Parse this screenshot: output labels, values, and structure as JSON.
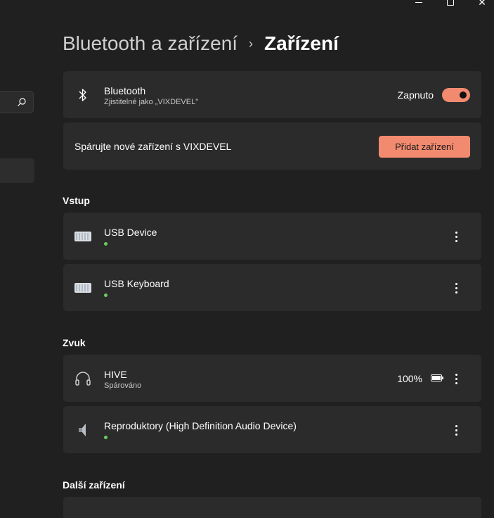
{
  "window": {
    "minimize_icon": "minimize-icon",
    "maximize_icon": "maximize-icon",
    "close_icon": "close-icon"
  },
  "nav": {
    "search_icon": "search-icon"
  },
  "breadcrumb": {
    "parent": "Bluetooth a zařízení",
    "separator": "›",
    "current": "Zařízení"
  },
  "bluetooth": {
    "title": "Bluetooth",
    "subtitle": "Zjistitelné jako „VIXDEVEL\"",
    "toggle_label": "Zapnuto",
    "toggle_on": true
  },
  "pair": {
    "text": "Spárujte nové zařízení s VIXDEVEL",
    "button_label": "Přidat zařízení"
  },
  "sections": {
    "input": "Vstup",
    "audio": "Zvuk",
    "other": "Další zařízení"
  },
  "input_devices": [
    {
      "name": "USB Device",
      "icon": "keyboard-icon",
      "connected": true
    },
    {
      "name": "USB Keyboard",
      "icon": "keyboard-icon",
      "connected": true
    }
  ],
  "audio_devices": [
    {
      "name": "HIVE",
      "status": "Spárováno",
      "battery": "100%",
      "icon": "headphones-icon"
    },
    {
      "name": "Reproduktory (High Definition Audio Device)",
      "icon": "speaker-icon",
      "connected": true
    }
  ],
  "colors": {
    "accent": "#f28a6f",
    "background": "#202020",
    "card": "#2b2b2b",
    "connected_dot": "#6ccb5f"
  }
}
